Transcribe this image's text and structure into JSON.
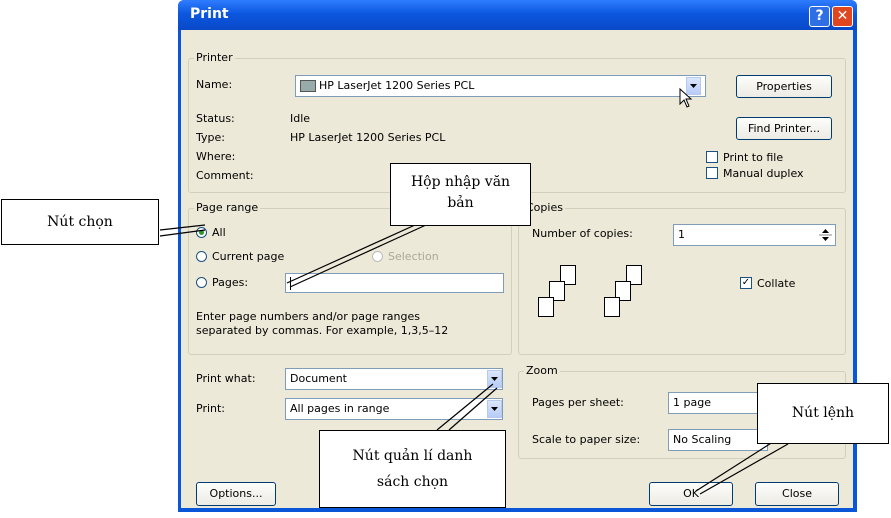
{
  "window": {
    "title": "Print",
    "help_glyph": "?",
    "close_glyph": "✕"
  },
  "printer": {
    "group_label": "Printer",
    "name_label": "Name:",
    "name_value": "HP LaserJet 1200 Series PCL",
    "status_label": "Status:",
    "status_value": "Idle",
    "type_label": "Type:",
    "type_value": "HP LaserJet 1200 Series PCL",
    "where_label": "Where:",
    "comment_label": "Comment:",
    "properties_button": "Properties",
    "find_printer_button": "Find Printer...",
    "print_to_file": "Print to file",
    "manual_duplex": "Manual duplex"
  },
  "page_range": {
    "group_label": "Page range",
    "all": "All",
    "current_page": "Current page",
    "selection": "Selection",
    "pages": "Pages:",
    "help_line1": "Enter page numbers and/or page ranges",
    "help_line2": "separated by commas.  For example, 1,3,5–12"
  },
  "copies": {
    "group_label": "Copies",
    "number_label": "Number of copies:",
    "number_value": "1",
    "collate": "Collate"
  },
  "print_what": {
    "label": "Print what:",
    "value": "Document"
  },
  "print": {
    "label": "Print:",
    "value": "All pages in range"
  },
  "zoom": {
    "group_label": "Zoom",
    "pages_per_sheet_label": "Pages per sheet:",
    "pages_per_sheet_value": "1 page",
    "scale_label": "Scale to paper size:",
    "scale_value": "No Scaling"
  },
  "footer": {
    "options_button": "Options...",
    "ok_button": "OK",
    "close_button": "Close"
  },
  "annotations": {
    "radio_button": "Nút chọn",
    "text_box_line1": "Hộp nhập văn",
    "text_box_line2": "bản",
    "list_button_line1": "Nút quản lí danh",
    "list_button_line2": "sách chọn",
    "command_button": "Nút lệnh"
  }
}
